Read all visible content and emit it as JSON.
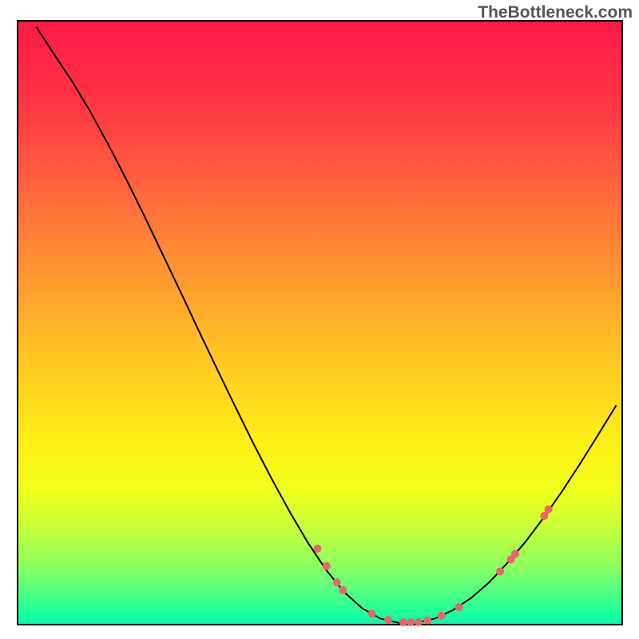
{
  "watermark": "TheBottleneck.com",
  "chart_data": {
    "type": "line",
    "title": "",
    "xlabel": "",
    "ylabel": "",
    "xlim": [
      0,
      100
    ],
    "ylim": [
      0,
      100
    ],
    "background_gradient": {
      "stops": [
        {
          "offset": 0.0,
          "color": "#ff1a48"
        },
        {
          "offset": 0.12,
          "color": "#ff3046"
        },
        {
          "offset": 0.24,
          "color": "#ff583f"
        },
        {
          "offset": 0.36,
          "color": "#ff8236"
        },
        {
          "offset": 0.48,
          "color": "#ffac2b"
        },
        {
          "offset": 0.6,
          "color": "#ffd31f"
        },
        {
          "offset": 0.7,
          "color": "#fff016"
        },
        {
          "offset": 0.78,
          "color": "#f0ff1c"
        },
        {
          "offset": 0.84,
          "color": "#c7ff3a"
        },
        {
          "offset": 0.9,
          "color": "#8fff5e"
        },
        {
          "offset": 0.95,
          "color": "#4cff86"
        },
        {
          "offset": 1.0,
          "color": "#00ffab"
        }
      ]
    },
    "curve": [
      {
        "x": 3.1,
        "y": 99.0
      },
      {
        "x": 6.0,
        "y": 94.5
      },
      {
        "x": 9.0,
        "y": 90.0
      },
      {
        "x": 12.0,
        "y": 85.0
      },
      {
        "x": 15.0,
        "y": 79.5
      },
      {
        "x": 18.0,
        "y": 73.7
      },
      {
        "x": 21.0,
        "y": 67.6
      },
      {
        "x": 24.0,
        "y": 61.3
      },
      {
        "x": 27.0,
        "y": 55.0
      },
      {
        "x": 30.0,
        "y": 48.6
      },
      {
        "x": 33.0,
        "y": 42.3
      },
      {
        "x": 36.0,
        "y": 36.1
      },
      {
        "x": 39.0,
        "y": 30.0
      },
      {
        "x": 42.0,
        "y": 24.2
      },
      {
        "x": 45.0,
        "y": 18.7
      },
      {
        "x": 48.0,
        "y": 13.6
      },
      {
        "x": 51.0,
        "y": 9.1
      },
      {
        "x": 54.0,
        "y": 5.4
      },
      {
        "x": 57.0,
        "y": 2.7
      },
      {
        "x": 60.0,
        "y": 1.0
      },
      {
        "x": 63.0,
        "y": 0.3
      },
      {
        "x": 66.0,
        "y": 0.3
      },
      {
        "x": 69.0,
        "y": 1.0
      },
      {
        "x": 72.0,
        "y": 2.4
      },
      {
        "x": 75.0,
        "y": 4.4
      },
      {
        "x": 78.0,
        "y": 7.0
      },
      {
        "x": 81.0,
        "y": 10.2
      },
      {
        "x": 84.0,
        "y": 13.7
      },
      {
        "x": 87.0,
        "y": 17.7
      },
      {
        "x": 90.0,
        "y": 22.0
      },
      {
        "x": 93.0,
        "y": 26.6
      },
      {
        "x": 96.0,
        "y": 31.4
      },
      {
        "x": 99.0,
        "y": 36.3
      }
    ],
    "dots": [
      {
        "x": 49.6,
        "y": 12.6
      },
      {
        "x": 51.1,
        "y": 9.7
      },
      {
        "x": 52.8,
        "y": 7.0
      },
      {
        "x": 53.8,
        "y": 5.7
      },
      {
        "x": 58.6,
        "y": 1.8
      },
      {
        "x": 61.3,
        "y": 0.8
      },
      {
        "x": 63.8,
        "y": 0.4
      },
      {
        "x": 65.0,
        "y": 0.4
      },
      {
        "x": 66.3,
        "y": 0.4
      },
      {
        "x": 67.8,
        "y": 0.7
      },
      {
        "x": 70.1,
        "y": 1.5
      },
      {
        "x": 73.0,
        "y": 2.9
      },
      {
        "x": 79.8,
        "y": 8.8
      },
      {
        "x": 81.6,
        "y": 10.8
      },
      {
        "x": 82.3,
        "y": 11.7
      },
      {
        "x": 87.1,
        "y": 18.0
      },
      {
        "x": 87.8,
        "y": 19.1
      }
    ],
    "dot_color": "#e8666a",
    "dot_radius": 5
  }
}
